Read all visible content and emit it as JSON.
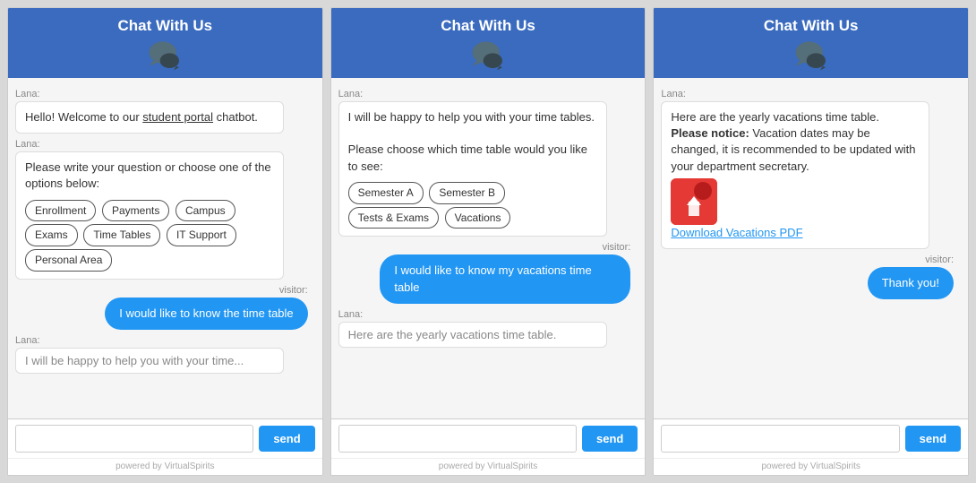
{
  "panel1": {
    "header": "Chat With Us",
    "messages": [
      {
        "type": "lana",
        "text": "Hello! Welcome to our student portal chatbot."
      },
      {
        "type": "lana",
        "text": "Please write your question or choose one of the options below:"
      },
      {
        "type": "options",
        "items": [
          "Enrollment",
          "Payments",
          "Campus",
          "Exams",
          "Time Tables",
          "IT Support",
          "Personal Area"
        ]
      },
      {
        "type": "visitor",
        "text": "I would like to know the time table"
      },
      {
        "type": "lana_partial",
        "text": "I will be happy to help you with your time..."
      }
    ],
    "input_placeholder": "",
    "send_label": "send",
    "powered_by": "powered by VirtualSpirits"
  },
  "panel2": {
    "header": "Chat With Us",
    "messages": [
      {
        "type": "lana",
        "text": "I will be happy to help you with your time tables.\n\nPlease choose which time table would you like to see:"
      },
      {
        "type": "options",
        "items": [
          "Semester A",
          "Semester B",
          "Tests & Exams",
          "Vacations"
        ]
      },
      {
        "type": "visitor",
        "text": "I would like to know my vacations time table"
      },
      {
        "type": "lana_partial",
        "text": "Here are the yearly vacations time table."
      }
    ],
    "input_placeholder": "",
    "send_label": "send",
    "powered_by": "powered by VirtualSpirits"
  },
  "panel3": {
    "header": "Chat With Us",
    "messages": [
      {
        "type": "lana_rich",
        "text1": "Here are the yearly vacations time table.",
        "notice": "Please notice:",
        "text2": " Vacation dates may be changed, it is recommended to be updated with your department secretary.",
        "pdf_link": "Download Vacations PDF"
      },
      {
        "type": "visitor",
        "text": "Thank you!"
      }
    ],
    "input_placeholder": "",
    "send_label": "send",
    "powered_by": "powered by VirtualSpirits"
  },
  "icons": {
    "chat_bubble": "💬",
    "pdf": "PDF"
  }
}
